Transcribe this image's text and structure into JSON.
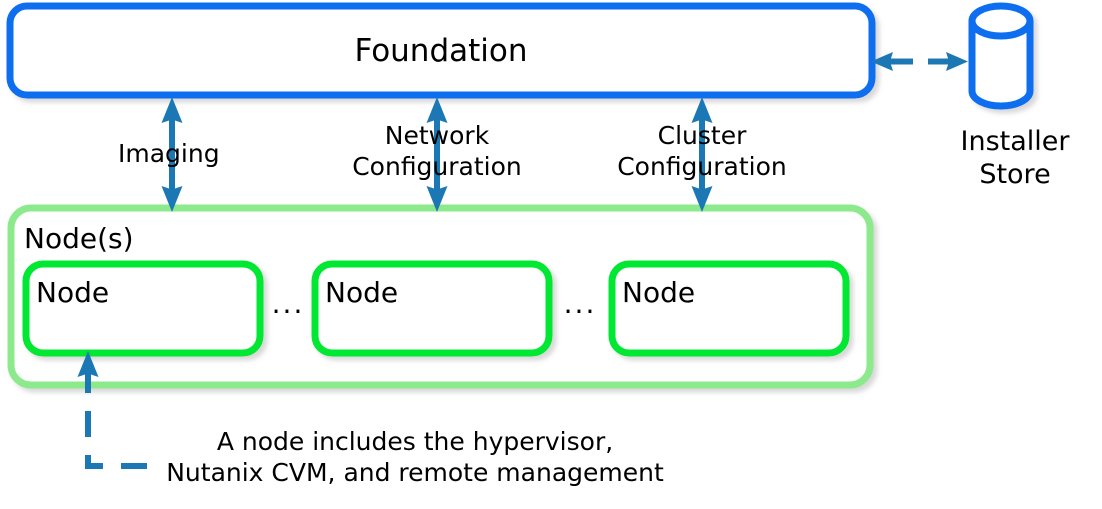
{
  "diagram": {
    "title_block": {
      "foundation_label": "Foundation"
    },
    "installer_store": {
      "label_line1": "Installer",
      "label_line2": "Store"
    },
    "connections": [
      {
        "id": "imaging",
        "label": "Imaging",
        "label_line1": "Imaging",
        "label_line2": ""
      },
      {
        "id": "network-configuration",
        "label": "Network Configuration",
        "label_line1": "Network",
        "label_line2": "Configuration"
      },
      {
        "id": "cluster-configuration",
        "label": "Cluster Configuration",
        "label_line1": "Cluster",
        "label_line2": "Configuration"
      }
    ],
    "nodes_container": {
      "label": "Node(s)",
      "nodes": [
        {
          "label": "Node"
        },
        {
          "label": "Node"
        },
        {
          "label": "Node"
        }
      ],
      "ellipsis": "..."
    },
    "callout": {
      "line1": "A node includes the hypervisor,",
      "line2": "Nutanix CVM, and remote management"
    },
    "colors": {
      "foundation_border": "#0a6ef0",
      "installer_store_border": "#0a6ef0",
      "arrow_blue": "#1c78b4",
      "node_border": "#00e832",
      "nodes_container_border": "#8ce98c",
      "text": "#000000",
      "background": "#ffffff",
      "shadow": "#e6e6e6"
    }
  }
}
